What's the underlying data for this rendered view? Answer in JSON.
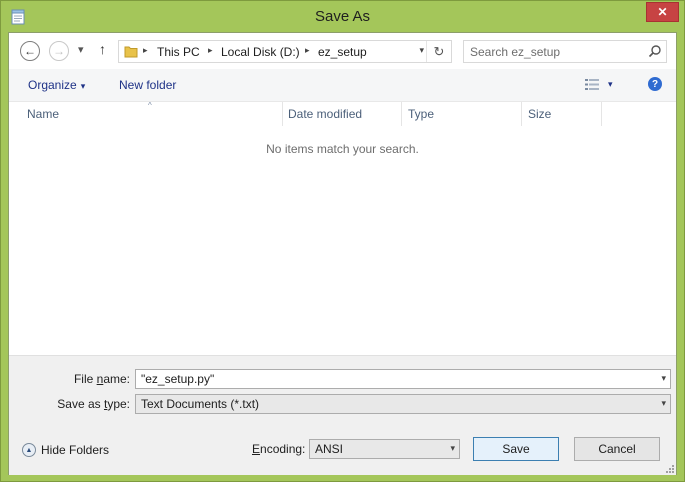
{
  "window": {
    "title": "Save As",
    "close_glyph": "✕",
    "title_icon": "notepad-icon",
    "frame_color": "#a4c65a",
    "close_color": "#c74343"
  },
  "nav": {
    "back_glyph": "←",
    "forward_glyph": "→",
    "recent_glyph": "▾",
    "up_glyph": "↑",
    "address": {
      "segments": [
        "This PC",
        "Local Disk (D:)",
        "ez_setup"
      ],
      "separator": "▸",
      "dropdown_glyph": "▾",
      "refresh_glyph": "↻"
    },
    "search": {
      "placeholder": "Search ez_setup",
      "value": ""
    }
  },
  "toolbar": {
    "organize_label": "Organize",
    "new_folder_label": "New folder",
    "caret": "▾",
    "help_glyph": "?",
    "accent_color": "#1e3287"
  },
  "columns": {
    "sort_indicator": "^",
    "headers": [
      "Name",
      "Date modified",
      "Type",
      "Size"
    ]
  },
  "file_list": {
    "empty_message": "No items match your search."
  },
  "form": {
    "file_name_label_pre": "File ",
    "file_name_label_u": "n",
    "file_name_label_post": "ame:",
    "file_name_value": "\"ez_setup.py\"",
    "save_type_label_pre": "Save as ",
    "save_type_label_u": "t",
    "save_type_label_post": "ype:",
    "save_type_value": "Text Documents (*.txt)",
    "encoding_label_pre": "",
    "encoding_label_u": "E",
    "encoding_label_post": "ncoding:",
    "encoding_value": "ANSI",
    "combo_caret": "▾"
  },
  "footer": {
    "hide_folders_label": "Hide Folders",
    "hide_folders_glyph": "▲",
    "save_label": "Save",
    "cancel_label": "Cancel"
  }
}
